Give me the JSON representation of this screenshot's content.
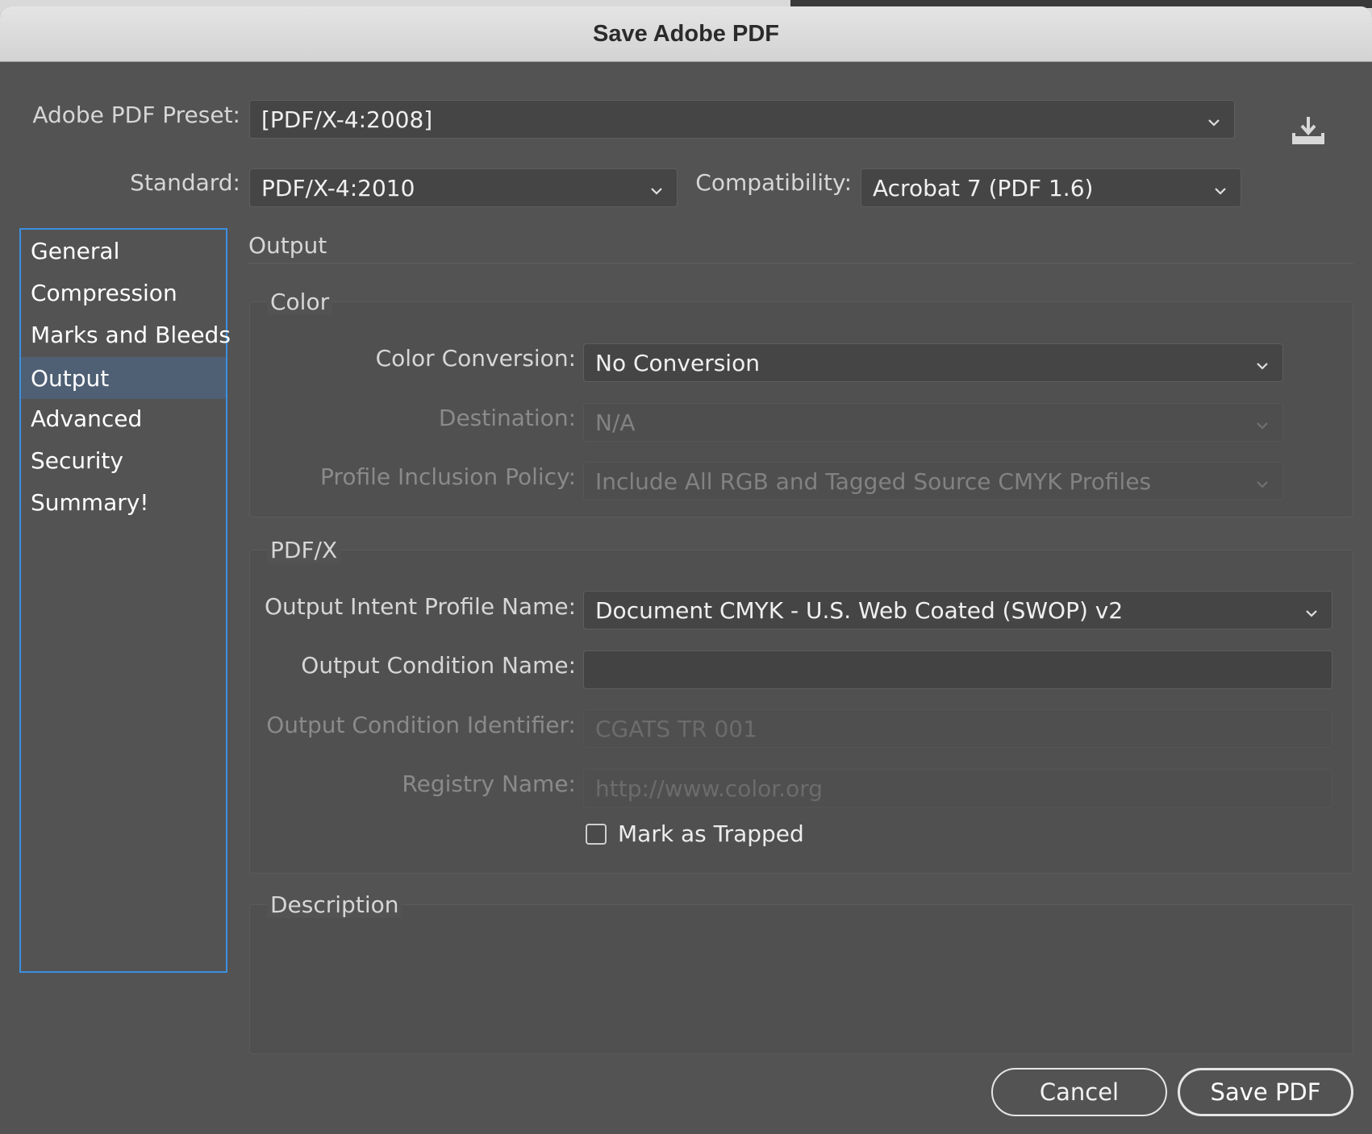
{
  "window": {
    "title": "Save Adobe PDF"
  },
  "preset": {
    "label": "Adobe PDF Preset:",
    "value": "[PDF/X-4:2008]"
  },
  "standard": {
    "label": "Standard:",
    "value": "PDF/X-4:2010"
  },
  "compatibility": {
    "label": "Compatibility:",
    "value": "Acrobat 7 (PDF 1.6)"
  },
  "sidebar": {
    "items": [
      {
        "label": "General"
      },
      {
        "label": "Compression"
      },
      {
        "label": "Marks and Bleeds"
      },
      {
        "label": "Output",
        "selected": true
      },
      {
        "label": "Advanced"
      },
      {
        "label": "Security"
      },
      {
        "label": "Summary!"
      }
    ]
  },
  "panel": {
    "title": "Output"
  },
  "color": {
    "title": "Color",
    "conversion": {
      "label": "Color Conversion:",
      "value": "No Conversion"
    },
    "destination": {
      "label": "Destination:",
      "value": "N/A"
    },
    "profile_policy": {
      "label": "Profile Inclusion Policy:",
      "value": "Include All RGB and Tagged Source CMYK Profiles"
    }
  },
  "pdfx": {
    "title": "PDF/X",
    "output_intent": {
      "label": "Output Intent Profile Name:",
      "value": "Document CMYK - U.S. Web Coated (SWOP) v2"
    },
    "output_condition_name": {
      "label": "Output Condition Name:",
      "value": ""
    },
    "output_condition_identifier": {
      "label": "Output Condition Identifier:",
      "value": "CGATS TR 001"
    },
    "registry_name": {
      "label": "Registry Name:",
      "value": "http://www.color.org"
    },
    "mark_trapped": {
      "label": "Mark as Trapped",
      "checked": false
    }
  },
  "description": {
    "title": "Description"
  },
  "buttons": {
    "cancel": "Cancel",
    "save": "Save PDF"
  },
  "icons": {
    "preset_save": "save-preset-icon",
    "dropdown": "chevron-down-icon"
  },
  "colors": {
    "focus_ring": "#3b8fe0",
    "selection": "#4f6075",
    "background": "#535353"
  }
}
